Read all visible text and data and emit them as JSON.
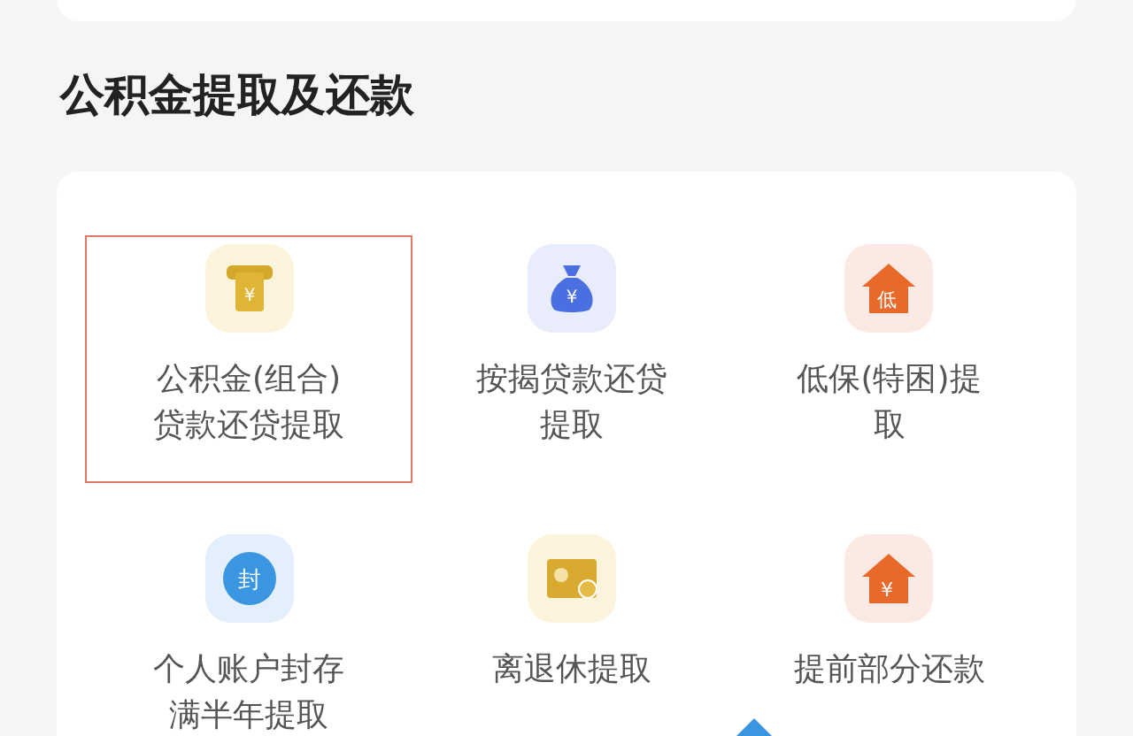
{
  "section": {
    "title": "公积金提取及还款"
  },
  "items": [
    {
      "kind": "slot",
      "glyph": "¥",
      "label": "公积金(组合)贷款还贷提取",
      "selected": true
    },
    {
      "kind": "bag",
      "glyph": "¥",
      "label": "按揭贷款还贷提取",
      "selected": false
    },
    {
      "kind": "house",
      "glyph": "低",
      "label": "低保(特困)提取",
      "selected": false
    },
    {
      "kind": "seal",
      "glyph": "封",
      "label": "个人账户封存满半年提取",
      "selected": false
    },
    {
      "kind": "card",
      "label": "离退休提取",
      "selected": false
    },
    {
      "kind": "house",
      "glyph": "¥",
      "label": "提前部分还款",
      "selected": false
    }
  ]
}
